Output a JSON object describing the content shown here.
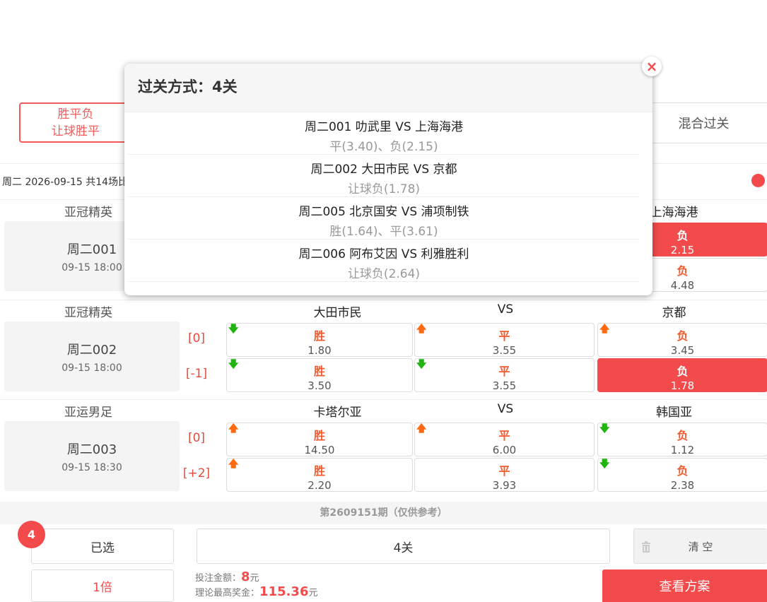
{
  "tabs": {
    "left_line1": "胜平负",
    "left_line2": "让球胜平",
    "right": "混合过关"
  },
  "date_row": "周二 2026-09-15 共14场比",
  "matches": [
    {
      "league": "亚冠精英",
      "num": "周二001",
      "time": "09-15 18:00",
      "home": "",
      "vs": "",
      "away": "上海海港",
      "hcap": [
        "",
        ""
      ],
      "r1": [
        {
          "k": "",
          "v": "",
          "arr": ""
        },
        {
          "k": "",
          "v": "",
          "arr": ""
        },
        {
          "k": "负",
          "v": "2.15",
          "arr": "",
          "sel": true
        }
      ],
      "r2": [
        {
          "k": "",
          "v": "",
          "arr": ""
        },
        {
          "k": "",
          "v": "",
          "arr": ""
        },
        {
          "k": "负",
          "v": "4.48",
          "arr": ""
        }
      ]
    },
    {
      "league": "亚冠精英",
      "num": "周二002",
      "time": "09-15 18:00",
      "home": "大田市民",
      "vs": "VS",
      "away": "京都",
      "hcap": [
        "[0]",
        "[-1]"
      ],
      "r1": [
        {
          "k": "胜",
          "v": "1.80",
          "arr": "down"
        },
        {
          "k": "平",
          "v": "3.55",
          "arr": "up"
        },
        {
          "k": "负",
          "v": "3.45",
          "arr": "up"
        }
      ],
      "r2": [
        {
          "k": "胜",
          "v": "3.50",
          "arr": "down"
        },
        {
          "k": "平",
          "v": "3.55",
          "arr": "down"
        },
        {
          "k": "负",
          "v": "1.78",
          "arr": "",
          "sel": true
        }
      ]
    },
    {
      "league": "亚运男足",
      "num": "周二003",
      "time": "09-15 18:30",
      "home": "卡塔尔亚",
      "vs": "VS",
      "away": "韩国亚",
      "hcap": [
        "[0]",
        "[+2]"
      ],
      "r1": [
        {
          "k": "胜",
          "v": "14.50",
          "arr": "up"
        },
        {
          "k": "平",
          "v": "6.00",
          "arr": "up"
        },
        {
          "k": "负",
          "v": "1.12",
          "arr": "down"
        }
      ],
      "r2": [
        {
          "k": "胜",
          "v": "2.20",
          "arr": "up"
        },
        {
          "k": "平",
          "v": "3.93",
          "arr": ""
        },
        {
          "k": "负",
          "v": "2.38",
          "arr": "down"
        }
      ]
    }
  ],
  "period": "第2609151期（仅供参考）",
  "footer": {
    "badge": "4",
    "selected": "已选",
    "pass_type": "4关",
    "clear": "清 空",
    "multiple": "1倍",
    "bet_label": "投注金额：",
    "bet_amount": "8",
    "bet_unit": "元",
    "max_label": "理论最高奖金：",
    "max_amount": "115.36",
    "max_unit": "元",
    "view": "查看方案"
  },
  "modal": {
    "title": "过关方式：4关",
    "close": "×",
    "rows": [
      {
        "title": "周二001 叻武里 VS 上海海港",
        "sub": "平(3.40)、负(2.15)"
      },
      {
        "title": "周二002 大田市民 VS 京都",
        "sub": "让球负(1.78)"
      },
      {
        "title": "周二005 北京国安 VS 浦项制铁",
        "sub": "胜(1.64)、平(3.61)"
      },
      {
        "title": "周二006 阿布艾因 VS 利雅胜利",
        "sub": "让球负(2.64)"
      }
    ]
  },
  "colors": {
    "accent": "#f34b4b",
    "up": "#ff6a10",
    "down": "#1fb40e"
  },
  "icons": {
    "up": "arrow-up-icon",
    "down": "arrow-down-icon",
    "trash": "trash-icon",
    "close": "close-icon"
  }
}
